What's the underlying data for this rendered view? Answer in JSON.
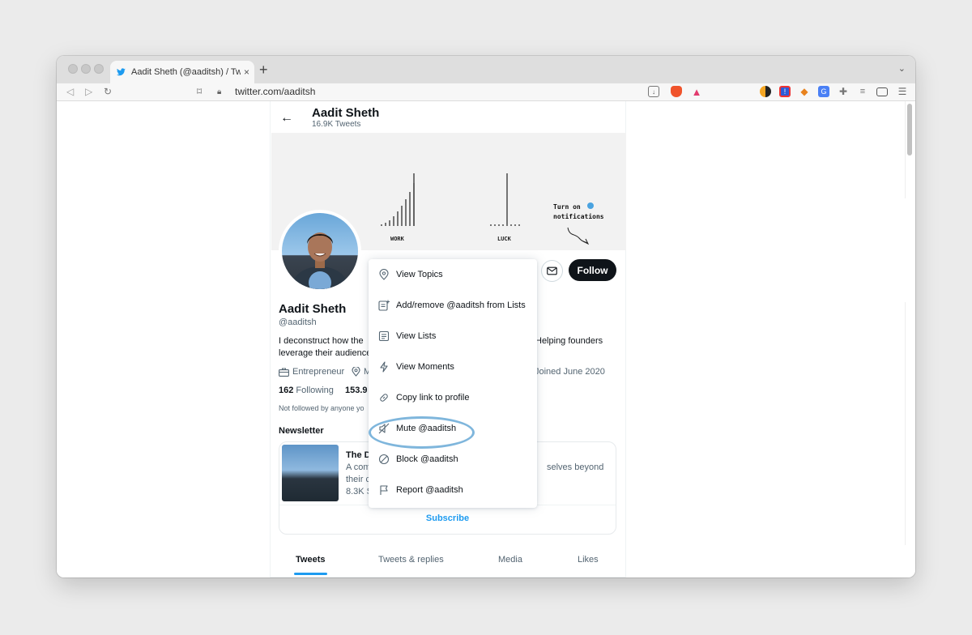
{
  "browser": {
    "tab_title": "Aadit Sheth (@aaditsh) / Twitter",
    "tab_close": "×",
    "new_tab": "+",
    "tab_menu": "⌄",
    "url": "twitter.com/aaditsh",
    "back": "◁",
    "forward": "▷",
    "reload": "↻",
    "bookmark": "⌑"
  },
  "header": {
    "back_icon": "←",
    "name": "Aadit Sheth",
    "tweet_count": "16.9K Tweets"
  },
  "banner": {
    "label_work": "WORK",
    "label_luck": "LUCK",
    "note_line1": "Turn on",
    "note_line2": "notifications"
  },
  "profile": {
    "follow_label": "Follow",
    "name": "Aadit Sheth",
    "handle": "@aaditsh",
    "bio_line1": "I deconstruct how the",
    "bio_line1_right": "Helping founders",
    "bio_line2": "leverage their audience",
    "category": "Entrepreneur",
    "location": "M",
    "joined": "Joined June 2020",
    "following_count": "162",
    "following_label": "Following",
    "followers_count": "153.9",
    "not_followed": "Not followed by anyone yo",
    "newsletter_heading": "Newsletter"
  },
  "newsletter_card": {
    "title": "The D",
    "desc_line1": "A com",
    "desc_line1_right": "selves beyond",
    "desc_line2": "their c",
    "desc_line3": "8.3K S",
    "subscribe": "Subscribe"
  },
  "profile_tabs": [
    {
      "label": "Tweets"
    },
    {
      "label": "Tweets & replies"
    },
    {
      "label": "Media"
    },
    {
      "label": "Likes"
    }
  ],
  "menu": {
    "items": [
      {
        "label": "View Topics",
        "icon": "topic-icon"
      },
      {
        "label": "Add/remove @aaditsh from Lists",
        "icon": "list-add-icon"
      },
      {
        "label": "View Lists",
        "icon": "list-icon"
      },
      {
        "label": "View Moments",
        "icon": "lightning-icon"
      },
      {
        "label": "Copy link to profile",
        "icon": "link-icon"
      },
      {
        "label": "Mute @aaditsh",
        "icon": "mute-icon"
      },
      {
        "label": "Block @aaditsh",
        "icon": "block-icon"
      },
      {
        "label": "Report @aaditsh",
        "icon": "flag-icon"
      }
    ]
  },
  "colors": {
    "accent": "#1d9bf0",
    "highlight_ring": "#7fb6dc",
    "follow_button": "#0f1419"
  }
}
